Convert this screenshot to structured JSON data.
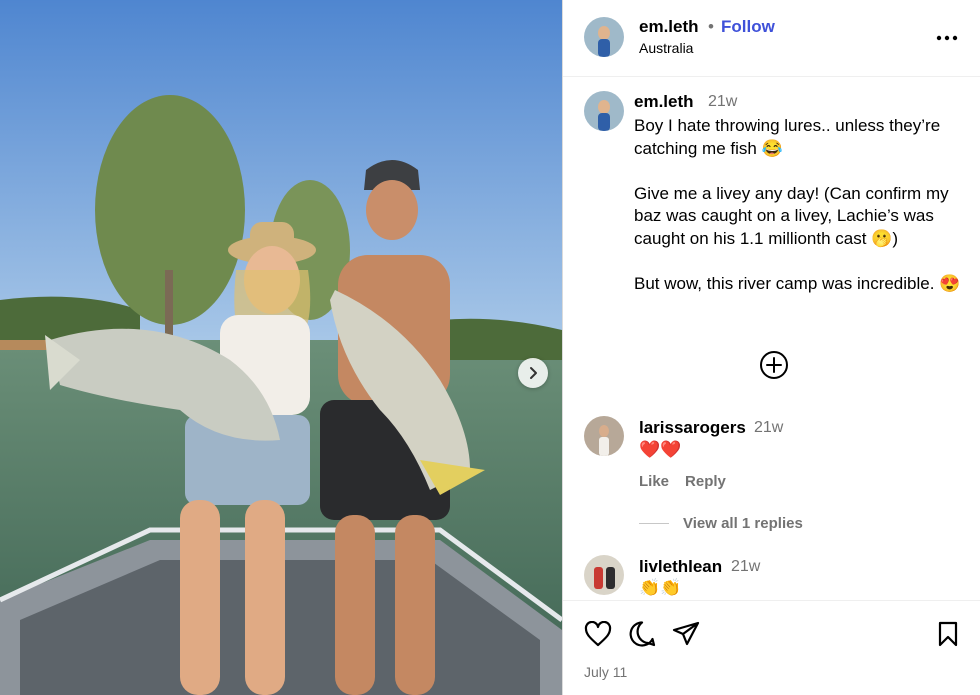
{
  "post": {
    "username": "em.leth",
    "separator": "•",
    "follow_label": "Follow",
    "location": "Australia",
    "more_icon": "more-horizontal-icon",
    "next_icon": "chevron-right-icon"
  },
  "caption": {
    "username": "em.leth",
    "time": "21w",
    "para1": "Boy I hate throwing lures.. unless they’re catching me fish 😂",
    "para2": "Give me a livey any day! (Can confirm my baz was caught on a livey, Lachie’s was caught on his 1.1 millionth cast 🫢)",
    "para3": "But wow, this river camp was incredible. 😍"
  },
  "load_more_icon": "plus-circle-icon",
  "comments": [
    {
      "username": "larissarogers",
      "time": "21w",
      "text": "❤️❤️",
      "like_label": "Like",
      "reply_label": "Reply",
      "view_replies": "View all 1 replies"
    },
    {
      "username": "livlethlean",
      "time": "21w",
      "text": "👏👏"
    }
  ],
  "footer": {
    "date": "July 11",
    "icons": [
      "heart-icon",
      "comment-icon",
      "share-icon",
      "bookmark-icon"
    ]
  },
  "colors": {
    "follow": "#3f51d9",
    "secondary_text": "#737373",
    "border": "#dbdbdb"
  }
}
